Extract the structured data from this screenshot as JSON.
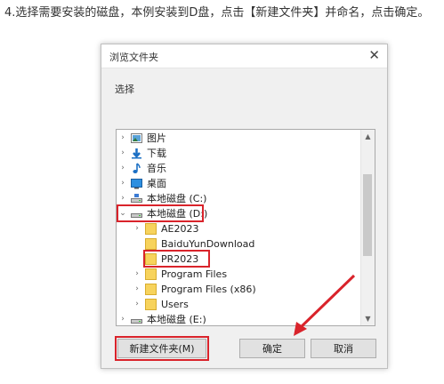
{
  "caption": "4.选择需要安装的磁盘，本例安装到D盘，点击【新建文件夹】并命名，点击确定。",
  "dialog": {
    "title": "浏览文件夹",
    "prompt": "选择",
    "tree": [
      {
        "label": "图片",
        "icon": "pictures-icon",
        "chevron": "›"
      },
      {
        "label": "下载",
        "icon": "download-icon",
        "chevron": "›"
      },
      {
        "label": "音乐",
        "icon": "music-icon",
        "chevron": "›"
      },
      {
        "label": "桌面",
        "icon": "desktop-icon",
        "chevron": "›"
      },
      {
        "label": "本地磁盘 (C:)",
        "icon": "drive-icon",
        "chevron": "›"
      },
      {
        "label": "本地磁盘 (D:)",
        "icon": "drive-icon",
        "chevron": "⌄"
      },
      {
        "label": "AE2023",
        "icon": "folder-icon",
        "chevron": "›"
      },
      {
        "label": "BaiduYunDownload",
        "icon": "folder-icon",
        "chevron": ""
      },
      {
        "label": "PR2023",
        "icon": "folder-icon",
        "chevron": ""
      },
      {
        "label": "Program Files",
        "icon": "folder-icon",
        "chevron": "›"
      },
      {
        "label": "Program Files (x86)",
        "icon": "folder-icon",
        "chevron": "›"
      },
      {
        "label": "Users",
        "icon": "folder-icon",
        "chevron": "›"
      },
      {
        "label": "本地磁盘 (E:)",
        "icon": "drive-icon",
        "chevron": "›"
      }
    ],
    "buttons": {
      "new_folder": "新建文件夹(M)",
      "ok": "确定",
      "cancel": "取消"
    },
    "close_glyph": "✕"
  },
  "colors": {
    "highlight": "#d9232b",
    "folder": "#f7d35c"
  }
}
